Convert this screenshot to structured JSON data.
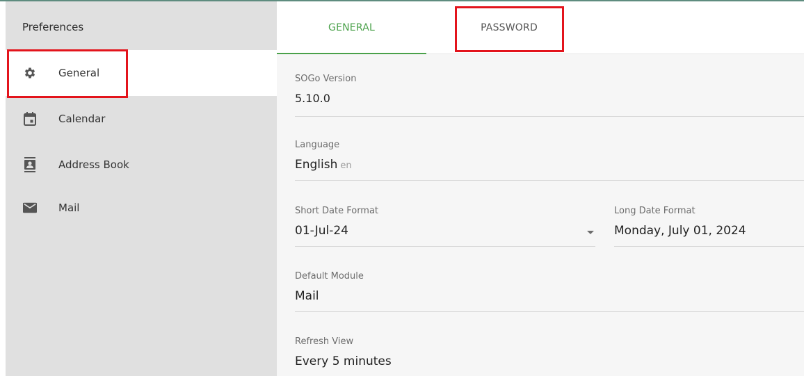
{
  "sidebar": {
    "title": "Preferences",
    "items": [
      {
        "label": "General",
        "icon": "gear-icon"
      },
      {
        "label": "Calendar",
        "icon": "calendar-icon"
      },
      {
        "label": "Address Book",
        "icon": "address-book-icon"
      },
      {
        "label": "Mail",
        "icon": "mail-icon"
      }
    ]
  },
  "tabs": {
    "general": "GENERAL",
    "password": "PASSWORD"
  },
  "fields": {
    "sogo_version": {
      "label": "SOGo Version",
      "value": "5.10.0"
    },
    "language": {
      "label": "Language",
      "value": "English",
      "code": "en"
    },
    "short_date": {
      "label": "Short Date Format",
      "value": "01-Jul-24"
    },
    "long_date": {
      "label": "Long Date Format",
      "value": "Monday, July 01, 2024"
    },
    "default_module": {
      "label": "Default Module",
      "value": "Mail"
    },
    "refresh_view": {
      "label": "Refresh View",
      "value": "Every 5 minutes"
    }
  },
  "colors": {
    "accent_green": "#4aa14a",
    "highlight_red": "#e3141c",
    "sidebar_bg": "#e0e0e0"
  }
}
